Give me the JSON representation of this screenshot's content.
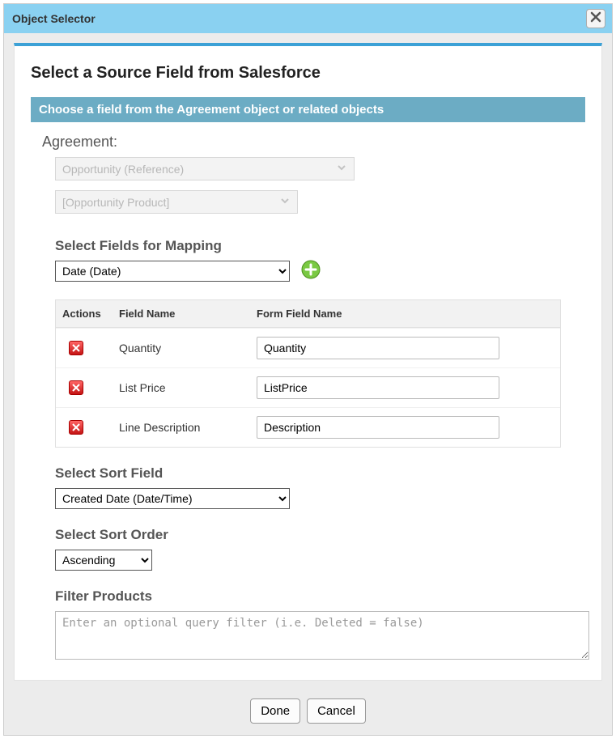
{
  "window": {
    "title": "Object Selector"
  },
  "page": {
    "heading": "Select a Source Field from Salesforce",
    "banner": "Choose a field from the Agreement object or related objects"
  },
  "agreement": {
    "label": "Agreement:",
    "select1": "Opportunity (Reference)",
    "select2": "[Opportunity Product]"
  },
  "mapping": {
    "label": "Select Fields for Mapping",
    "field_select_value": "Date (Date)",
    "columns": {
      "actions": "Actions",
      "field_name": "Field Name",
      "form_field_name": "Form Field Name"
    },
    "rows": [
      {
        "field_name": "Quantity",
        "form_field": "Quantity"
      },
      {
        "field_name": "List Price",
        "form_field": "ListPrice"
      },
      {
        "field_name": "Line Description",
        "form_field": "Description"
      }
    ]
  },
  "sort": {
    "field_label": "Select Sort Field",
    "field_value": "Created Date (Date/Time)",
    "order_label": "Select Sort Order",
    "order_value": "Ascending"
  },
  "filter": {
    "label": "Filter Products",
    "placeholder": "Enter an optional query filter (i.e. Deleted = false)"
  },
  "footer": {
    "done": "Done",
    "cancel": "Cancel"
  }
}
